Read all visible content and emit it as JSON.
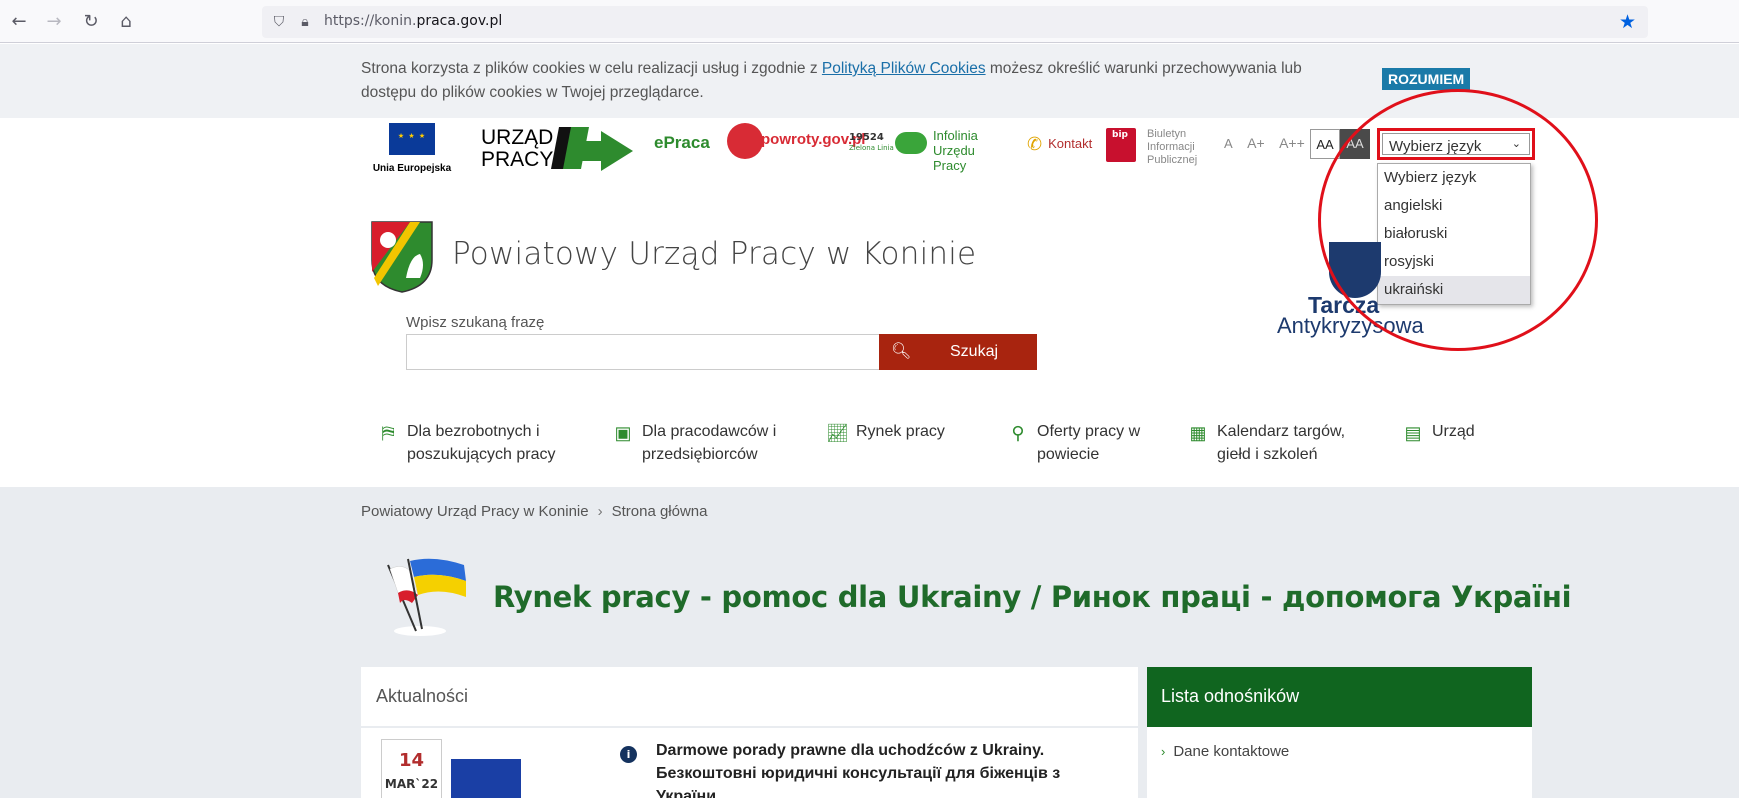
{
  "browser": {
    "url_prefix": "https://konin.",
    "url_domain": "praca.gov.pl"
  },
  "cookie_bar": {
    "text_before": "Strona korzysta z plików cookies w celu realizacji usług i zgodnie z ",
    "link_text": "Polityką Plików Cookies",
    "text_after": " możesz określić warunki przechowywania lub dostępu do plików cookies w Twojej przeglądarce.",
    "accept_label": "ROZUMIEM"
  },
  "top_links": {
    "eu_label": "Unia Europejska",
    "up_logo_line1": "URZĄD",
    "up_logo_line2": "PRACY",
    "epraca": "ePraca",
    "powroty": "powroty.gov.pl",
    "infolinia_number": "19524",
    "infolinia_sub": "Zielona Linia",
    "infolinia_line1": "Infolinia",
    "infolinia_line2": "Urzędu Pracy",
    "kontakt": "Kontakt",
    "bip_logo": "bip",
    "bip_line1": "Biuletyn",
    "bip_line2": "Informacji",
    "bip_line3": "Publicznej"
  },
  "accessibility": {
    "font_a": "A",
    "font_a_plus": "A+",
    "font_a_plusplus": "A++",
    "contrast_normal": "AA",
    "contrast_high": "AA"
  },
  "language": {
    "selected": "Wybierz język",
    "options": [
      "Wybierz język",
      "angielski",
      "białoruski",
      "rosyjski",
      "ukraiński"
    ],
    "highlighted_index": 4
  },
  "header": {
    "title": "Powiatowy Urząd Pracy w Koninie",
    "tarcza_line1": "Tarcza",
    "tarcza_line2": "Antykryzysowa"
  },
  "search": {
    "label": "Wpisz szukaną frazę",
    "value": "",
    "button": "Szukaj"
  },
  "menu": [
    {
      "line1": "Dla bezrobotnych i",
      "line2": "poszukujących pracy",
      "icon": "signpost-icon"
    },
    {
      "line1": "Dla pracodawców i",
      "line2": "przedsiębiorców",
      "icon": "briefcase-icon"
    },
    {
      "line1": "Rynek pracy",
      "line2": "",
      "icon": "chart-icon"
    },
    {
      "line1": "Oferty pracy w",
      "line2": "powiecie",
      "icon": "search-icon"
    },
    {
      "line1": "Kalendarz targów,",
      "line2": "giełd i szkoleń",
      "icon": "calendar-icon"
    },
    {
      "line1": "Urząd",
      "line2": "",
      "icon": "building-icon"
    }
  ],
  "breadcrumb": {
    "item1": "Powiatowy Urząd Pracy w Koninie",
    "separator": "›",
    "item2": "Strona główna"
  },
  "headline": "Rynek pracy - pomoc dla Ukrainy / Ринок праці - допомога Україні",
  "news": {
    "header": "Aktualności",
    "day": "14",
    "month": "MAR`22",
    "title": "Darmowe porady prawne dla uchodźców z Ukrainy. Безкоштовні юридичні консультації для біженців з України."
  },
  "links": {
    "header": "Lista odnośników",
    "item1": "Dane kontaktowe"
  },
  "colors": {
    "accent_green": "#1f6b2a",
    "search_button": "#a8240f",
    "annotation_red": "#e0101a"
  }
}
